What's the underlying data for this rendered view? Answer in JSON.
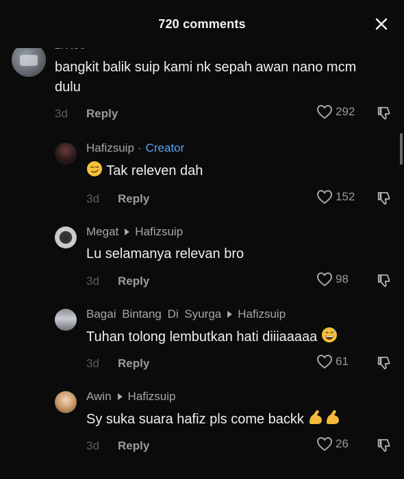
{
  "header": {
    "title": "720 comments",
    "close_icon": "close-icon"
  },
  "comment": {
    "username": "z.vtec",
    "text": "bangkit balik suip kami nk sepah awan nano mcm dulu",
    "time": "3d",
    "reply_label": "Reply",
    "likes": "292"
  },
  "replies": [
    {
      "username": "Hafizsuip",
      "separator": "·",
      "badge": "Creator",
      "text": "Tak releven dah",
      "emoji_before": "smirk-face-emoji",
      "time": "3d",
      "reply_label": "Reply",
      "likes": "152"
    },
    {
      "username": "Megat",
      "reply_to": "Hafizsuip",
      "text": "Lu selamanya relevan bro",
      "time": "3d",
      "reply_label": "Reply",
      "likes": "98"
    },
    {
      "username": "Bagai Bintang Di Syurga",
      "reply_to": "Hafizsuip",
      "text": "Tuhan tolong lembutkan hati diiiaaaaa",
      "emoji_after": "grinning-sweat-emoji",
      "time": "3d",
      "reply_label": "Reply",
      "likes": "61"
    },
    {
      "username": "Awin",
      "reply_to": "Hafizsuip",
      "text": "Sy suka suara hafiz pls come backk",
      "emoji_after": "flexed-biceps-emoji",
      "time": "3d",
      "reply_label": "Reply",
      "likes": "26"
    }
  ],
  "colors": {
    "background": "#0b0b0b",
    "creator_badge": "#5aa6ff",
    "text_primary": "#efefef",
    "text_secondary": "#9a9a9a"
  }
}
